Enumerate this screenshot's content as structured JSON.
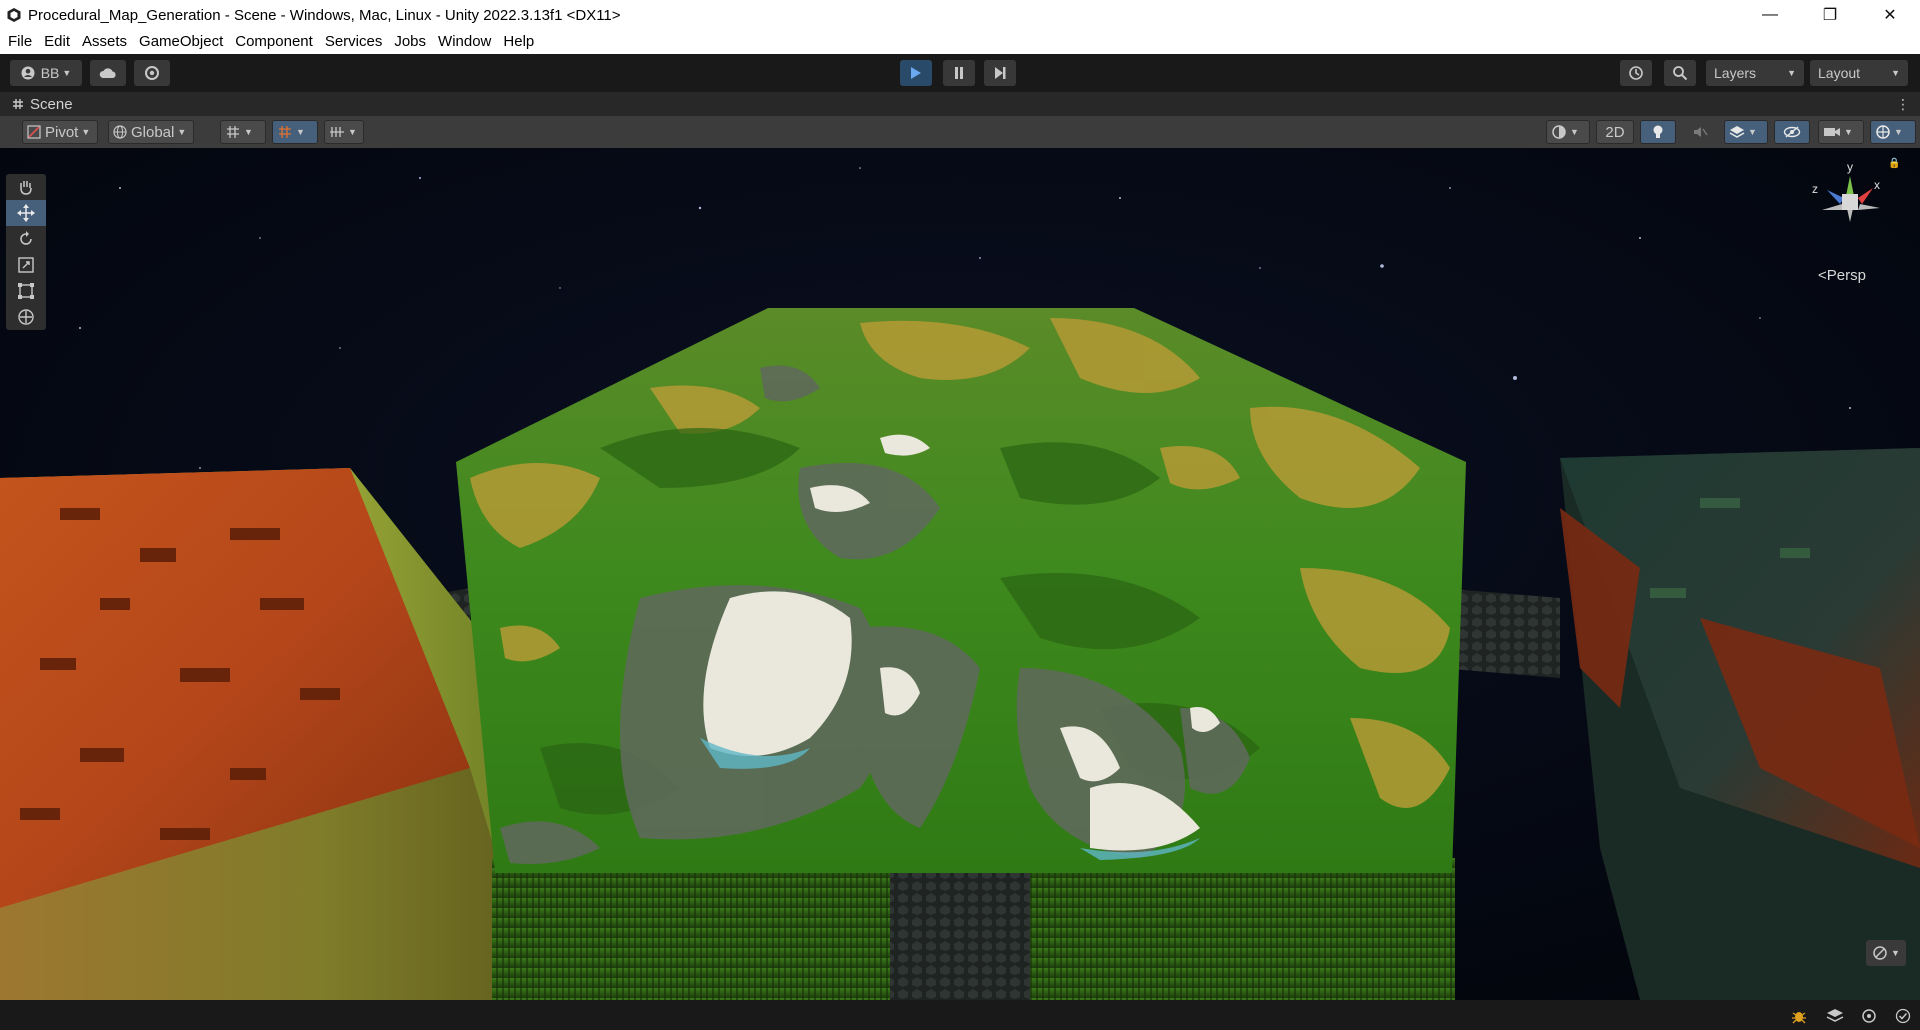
{
  "window": {
    "title": "Procedural_Map_Generation - Scene - Windows, Mac, Linux - Unity 2022.3.13f1 <DX11>",
    "minimize_glyph": "—",
    "maximize_glyph": "❐",
    "close_glyph": "✕"
  },
  "menu": [
    "File",
    "Edit",
    "Assets",
    "GameObject",
    "Component",
    "Services",
    "Jobs",
    "Window",
    "Help"
  ],
  "toolbar": {
    "account_label": "BB",
    "layers_label": "Layers",
    "layout_label": "Layout"
  },
  "scene_tab": {
    "label": "Scene"
  },
  "scene_toolbar": {
    "pivot_label": "Pivot",
    "global_label": "Global",
    "mode_2d_label": "2D"
  },
  "gizmo": {
    "y_label": "y",
    "x_label": "x",
    "z_label": "z",
    "projection_label": "<Persp"
  },
  "colors": {
    "accent": "#46607c",
    "play_active": "#2a4a6a",
    "terrain_green": "#3f8a1e",
    "terrain_yellow": "#b59a35",
    "terrain_snow": "#eae7dc",
    "terrain_rock": "#5e6a5a",
    "terrain_red": "#b4461a",
    "space": "#05080f"
  },
  "icons": [
    "unity-logo-icon",
    "account-icon",
    "cloud-icon",
    "collab-icon",
    "play-icon",
    "pause-icon",
    "step-icon",
    "history-icon",
    "search-icon",
    "hand-tool-icon",
    "move-tool-icon",
    "rotate-tool-icon",
    "scale-tool-icon",
    "rect-tool-icon",
    "transform-tool-icon",
    "lighting-icon",
    "audio-icon",
    "effects-icon",
    "hidden-icon",
    "camera-icon",
    "gizmos-icon",
    "lock-icon"
  ]
}
